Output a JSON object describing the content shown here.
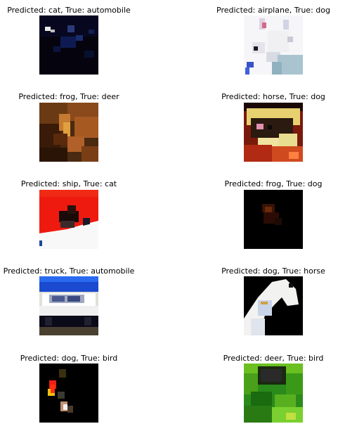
{
  "panels": [
    {
      "title": "Predicted: cat, True: automobile"
    },
    {
      "title": "Predicted: airplane, True: dog"
    },
    {
      "title": "Predicted: frog, True: deer"
    },
    {
      "title": "Predicted: horse, True: dog"
    },
    {
      "title": "Predicted: ship, True: cat"
    },
    {
      "title": "Predicted: frog, True: dog"
    },
    {
      "title": "Predicted: truck, True: automobile"
    },
    {
      "title": "Predicted: dog, True: horse"
    },
    {
      "title": "Predicted: dog, True: bird"
    },
    {
      "title": "Predicted: deer, True: bird"
    }
  ]
}
